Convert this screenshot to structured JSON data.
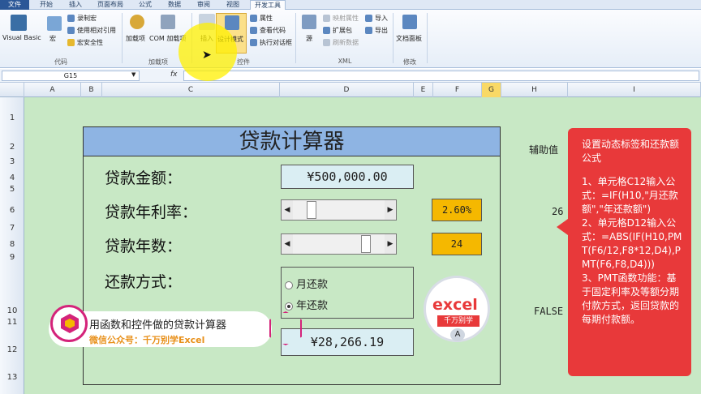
{
  "menu": {
    "tabs": [
      "文件",
      "开始",
      "插入",
      "页面布局",
      "公式",
      "数据",
      "审阅",
      "视图",
      "开发工具"
    ]
  },
  "ribbon": {
    "code": {
      "visual_basic": "Visual Basic",
      "macro": "宏",
      "record_macro": "录制宏",
      "relative_ref": "使用相对引用",
      "macro_security": "宏安全性",
      "group": "代码"
    },
    "addins": {
      "addins": "加载项",
      "com_addins": "COM 加载项",
      "group": "加载项"
    },
    "controls": {
      "insert": "插入",
      "design_mode": "设计模式",
      "properties": "属性",
      "view_code": "查看代码",
      "run_dialog": "执行对话框",
      "group": "控件"
    },
    "xml": {
      "source": "源",
      "map_properties": "映射属性",
      "expansion_packs": "扩展包",
      "refresh_data": "刷新数据",
      "import": "导入",
      "export": "导出",
      "group": "XML"
    },
    "modify": {
      "doc_panel": "文档面板",
      "group": "修改"
    }
  },
  "formula_bar": {
    "name_box": "G15",
    "fx": "fx",
    "value": ""
  },
  "columns": [
    "A",
    "B",
    "C",
    "D",
    "E",
    "F",
    "G",
    "H",
    "I"
  ],
  "selected_column": "G",
  "rows": [
    "1",
    "2",
    "3",
    "4",
    "5",
    "6",
    "7",
    "8",
    "9",
    "10",
    "11",
    "12",
    "13"
  ],
  "calculator": {
    "title": "贷款计算器",
    "loan_amount_label": "贷款金额：",
    "loan_amount_value": "¥500,000.00",
    "rate_label": "贷款年利率：",
    "rate_value": "2.60%",
    "rate_slider_fraction": 0.17,
    "years_label": "贷款年数：",
    "years_value": "24",
    "years_slider_fraction": 0.83,
    "repay_label": "还款方式：",
    "option_monthly": "月还款",
    "option_yearly": "年还款",
    "selected_option": "年还款",
    "result_value": "¥28,266.19"
  },
  "helper": {
    "title": "辅助值",
    "value_26": "26",
    "value_false": "FALSE"
  },
  "note": {
    "lines": [
      "设置动态标签和还款额公式",
      "",
      "1、单元格C12输入公式：=IF(H10,\"月还款额\",\"年还款额\")",
      "2、单元格D12输入公式：=ABS(IF(H10,PMT(F6/12,F8*12,D4),PMT(F6,F8,D4)))",
      "3、PMT函数功能：基于固定利率及等额分期付款方式，返回贷款的每期付款额。"
    ]
  },
  "overlay": {
    "banner_line1": "用函数和控件做的贷款计算器",
    "banner_line2": "微信公众号：千万别学Excel",
    "logo_text": "excel",
    "logo_sub": "千万别学",
    "logo_letter": "A"
  },
  "colors": {
    "title_bg": "#8eb4e3",
    "value_bg": "#daeef3",
    "accent_orange": "#f5b800",
    "note_red": "#e8393a",
    "sheet_green": "#c8e8c5"
  }
}
